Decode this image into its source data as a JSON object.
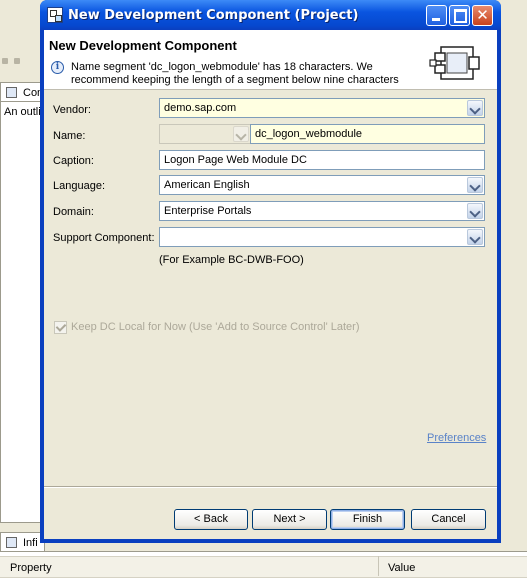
{
  "background": {
    "outline_tab_label": "Con",
    "outline_text": "An outli",
    "info_tab_label": "Infi",
    "properties": {
      "col_property": "Property",
      "col_value": "Value"
    }
  },
  "window": {
    "title": "New Development Component (Project)",
    "controls": {
      "minimize_icon": "minimize-icon",
      "maximize_icon": "maximize-icon",
      "close_glyph": "✕"
    }
  },
  "header": {
    "title": "New Development Component",
    "info_glyph": "i",
    "message": "Name segment 'dc_logon_webmodule' has 18 characters. We recommend keeping the length of a segment below nine characters"
  },
  "form": {
    "vendor": {
      "label": "Vendor:",
      "value": "demo.sap.com"
    },
    "name": {
      "label": "Name:",
      "prefix_value": "",
      "value": "dc_logon_webmodule"
    },
    "caption": {
      "label": "Caption:",
      "value": "Logon Page Web Module DC"
    },
    "language": {
      "label": "Language:",
      "value": "American English"
    },
    "domain": {
      "label": "Domain:",
      "value": "Enterprise Portals"
    },
    "support_component": {
      "label": "Support Component:",
      "value": "",
      "hint": "(For Example BC-DWB-FOO)"
    },
    "keep_local": {
      "label": "Keep DC Local for Now (Use 'Add to Source Control' Later)",
      "checked": true,
      "enabled": false
    }
  },
  "preferences_link": "Preferences",
  "buttons": {
    "back": "< Back",
    "next": "Next >",
    "finish": "Finish",
    "cancel": "Cancel"
  }
}
